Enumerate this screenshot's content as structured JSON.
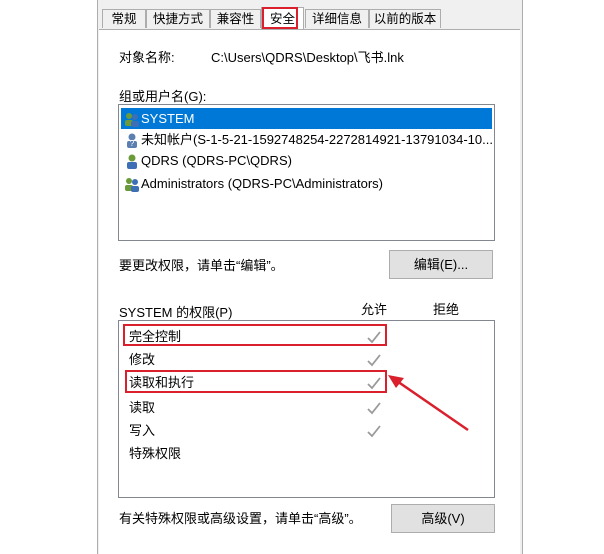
{
  "tabs": [
    {
      "label": "常规"
    },
    {
      "label": "快捷方式"
    },
    {
      "label": "兼容性"
    },
    {
      "label": "安全"
    },
    {
      "label": "详细信息"
    },
    {
      "label": "以前的版本"
    }
  ],
  "object_label": "对象名称:",
  "object_value": "C:\\Users\\QDRS\\Desktop\\飞书.lnk",
  "groups_label": "组或用户名(G):",
  "users": [
    {
      "name": "SYSTEM",
      "icon": "users-icon"
    },
    {
      "name": "未知帐户(S-1-5-21-1592748254-2272814921-13791034-10...",
      "icon": "unknown-user-icon"
    },
    {
      "name": "QDRS (QDRS-PC\\QDRS)",
      "icon": "user-icon"
    },
    {
      "name": "Administrators (QDRS-PC\\Administrators)",
      "icon": "users-icon"
    }
  ],
  "change_hint": "要更改权限，请单击“编辑”。",
  "edit_button": "编辑(E)...",
  "permissions_label": "SYSTEM 的权限(P)",
  "allow_header": "允许",
  "deny_header": "拒绝",
  "permissions": [
    {
      "name": "完全控制",
      "allow": true
    },
    {
      "name": "修改",
      "allow": true
    },
    {
      "name": "读取和执行",
      "allow": true
    },
    {
      "name": "读取",
      "allow": true
    },
    {
      "name": "写入",
      "allow": true
    },
    {
      "name": "特殊权限",
      "allow": false
    }
  ],
  "advanced_hint": "有关特殊权限或高级设置，请单击“高级”。",
  "advanced_button": "高级(V)",
  "colors": {
    "highlight": "#d9202c",
    "selection": "#0078d7",
    "check": "#9a9a9a"
  }
}
